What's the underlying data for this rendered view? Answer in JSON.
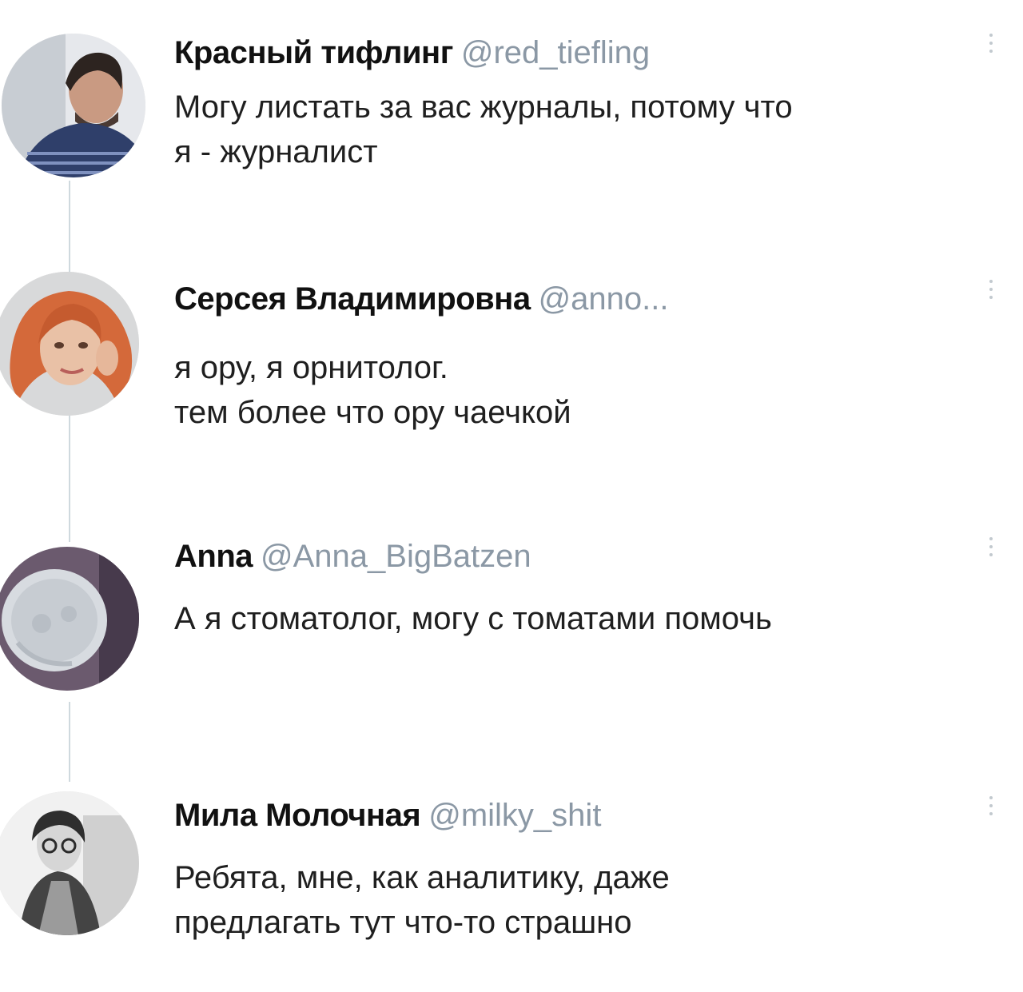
{
  "thread": {
    "tweets": [
      {
        "author_name": "Красный тифлинг",
        "handle": "@red_tiefling",
        "text": "Могу листать за вас журналы, потому что\nя - журналист",
        "avatar_icon": "man-portrait-avatar"
      },
      {
        "author_name": "Серсея Владимировна",
        "handle": "@anno...",
        "text": "я ору, я орнитолог.\nтем более что ору чаечкой",
        "avatar_icon": "woman-red-hair-avatar"
      },
      {
        "author_name": "Anna",
        "handle": "@Anna_BigBatzen",
        "text": "А я стоматолог, могу с томатами помочь",
        "avatar_icon": "xray-skull-avatar"
      },
      {
        "author_name": "Мила Молочная",
        "handle": "@milky_shit",
        "text": "Ребята, мне, как аналитику, даже\nпредлагать тут что-то страшно",
        "avatar_icon": "woman-glasses-avatar"
      }
    ],
    "more_icon": "vertical-ellipsis-icon"
  }
}
